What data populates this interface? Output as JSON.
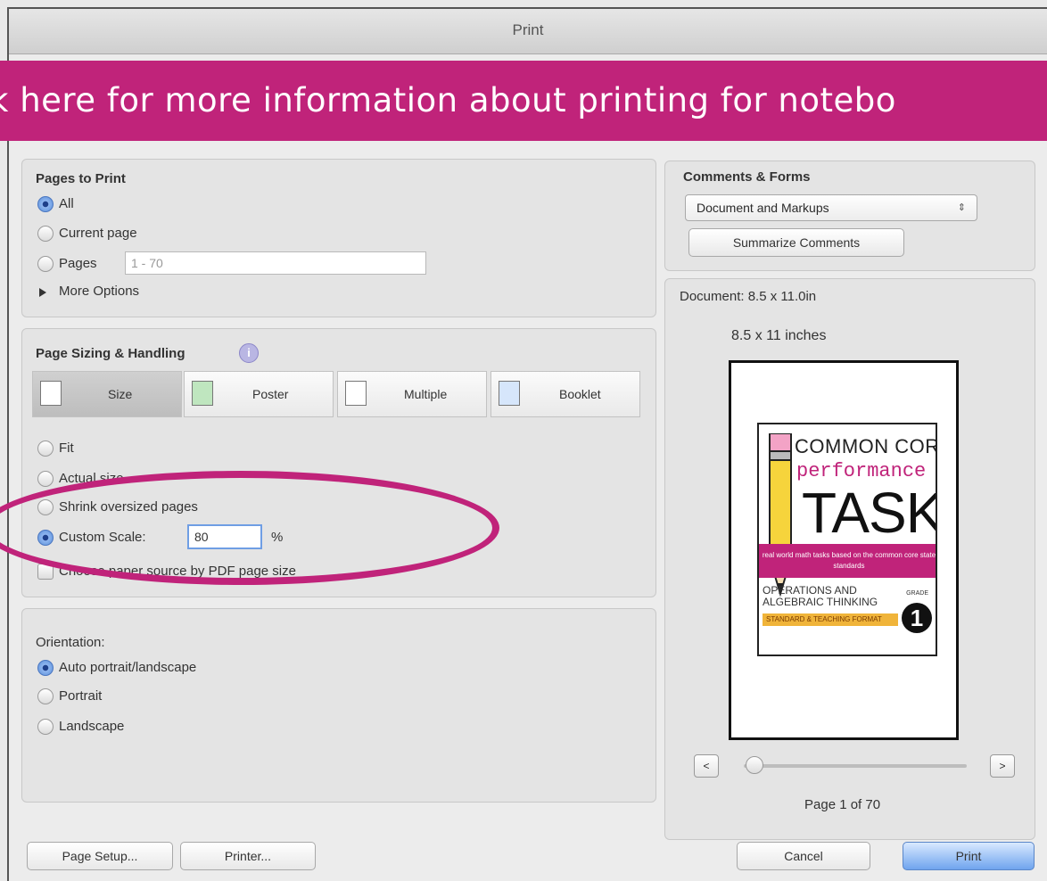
{
  "window": {
    "title": "Print"
  },
  "banner": {
    "text": "k here for more information about printing for notebo"
  },
  "pages_to_print": {
    "heading": "Pages to Print",
    "options": [
      "All",
      "Current page",
      "Pages"
    ],
    "selected": "All",
    "pages_range_placeholder": "1 - 70",
    "more_options": "More Options"
  },
  "page_sizing": {
    "heading": "Page Sizing & Handling",
    "tabs": [
      "Size",
      "Poster",
      "Multiple",
      "Booklet"
    ],
    "selected_tab": "Size",
    "options": [
      "Fit",
      "Actual size",
      "Shrink oversized pages",
      "Custom Scale:"
    ],
    "selected": "Custom Scale:",
    "custom_scale_value": "80",
    "percent": "%",
    "paper_source": "Choose paper source by PDF page size"
  },
  "orientation": {
    "heading": "Orientation:",
    "options": [
      "Auto portrait/landscape",
      "Portrait",
      "Landscape"
    ],
    "selected": "Auto portrait/landscape"
  },
  "comments_forms": {
    "heading": "Comments & Forms",
    "select_value": "Document and Markups",
    "summarize": "Summarize Comments"
  },
  "preview": {
    "document_size": "Document: 8.5 x 11.0in",
    "paper_size": "8.5 x 11 inches",
    "page_indicator": "Page 1 of 70",
    "prev": "<",
    "next": ">"
  },
  "cover": {
    "line1": "COMMON CORE",
    "line2": "performance",
    "line3": "TASKS",
    "band": "real world math tasks based on the common core state standards",
    "topic": "OPERATIONS AND ALGEBRAIC THINKING",
    "strip": "STANDARD & TEACHING FORMAT",
    "grade_label": "GRADE",
    "grade": "1"
  },
  "buttons": {
    "page_setup": "Page Setup...",
    "printer": "Printer...",
    "cancel": "Cancel",
    "print": "Print"
  },
  "colors": {
    "banner": "#c0237a",
    "annotation": "#c0237a"
  }
}
